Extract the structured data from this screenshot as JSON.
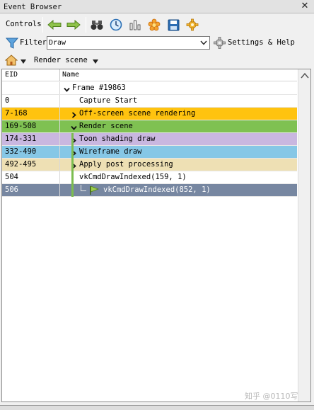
{
  "window": {
    "title": "Event Browser",
    "close_glyph": "✕"
  },
  "toolbar": {
    "controls_label": "Controls",
    "icons": [
      "back-arrow-icon",
      "forward-arrow-icon",
      "find-binoculars-icon",
      "timeline-clock-icon",
      "statistics-bars-icon",
      "bookmark-flower-icon",
      "save-disk-icon",
      "settings-gear-icon"
    ]
  },
  "filter": {
    "label": "Filter",
    "value": "Draw",
    "settings_label": "Settings & Help"
  },
  "breadcrumb": {
    "current": "Render scene"
  },
  "tree": {
    "columns": [
      "EID",
      "Name"
    ],
    "rows": [
      {
        "eid": "",
        "name": "Frame #19863",
        "bg": "#ffffff",
        "fg": "#000000",
        "indent": 0,
        "expander": "down"
      },
      {
        "eid": "0",
        "name": "Capture Start",
        "bg": "#ffffff",
        "fg": "#000000",
        "indent": 1,
        "expander": "none"
      },
      {
        "eid": "7-168",
        "name": "Off-screen scene rendering",
        "bg": "#ffc30f",
        "fg": "#000000",
        "indent": 1,
        "expander": "right"
      },
      {
        "eid": "169-508",
        "name": "Render scene",
        "bg": "#7fc152",
        "fg": "#000000",
        "indent": 1,
        "expander": "down"
      },
      {
        "eid": "174-331",
        "name": "Toon shading draw",
        "bg": "#c9b7e0",
        "fg": "#000000",
        "indent": 2,
        "expander": "right"
      },
      {
        "eid": "332-490",
        "name": "Wireframe draw",
        "bg": "#86c7e6",
        "fg": "#000000",
        "indent": 2,
        "expander": "right"
      },
      {
        "eid": "492-495",
        "name": "Apply post processing",
        "bg": "#eee0b4",
        "fg": "#000000",
        "indent": 2,
        "expander": "right"
      },
      {
        "eid": "504",
        "name": "vkCmdDrawIndexed(159, 1)",
        "bg": "#ffffff",
        "fg": "#000000",
        "indent": 2,
        "expander": "none"
      },
      {
        "eid": "506",
        "name": "vkCmdDrawIndexed(852, 1)",
        "bg": "#7787a1",
        "fg": "#ffffff",
        "indent": 3,
        "expander": "none",
        "flag": true
      }
    ]
  },
  "watermark": "知乎 @0110写"
}
